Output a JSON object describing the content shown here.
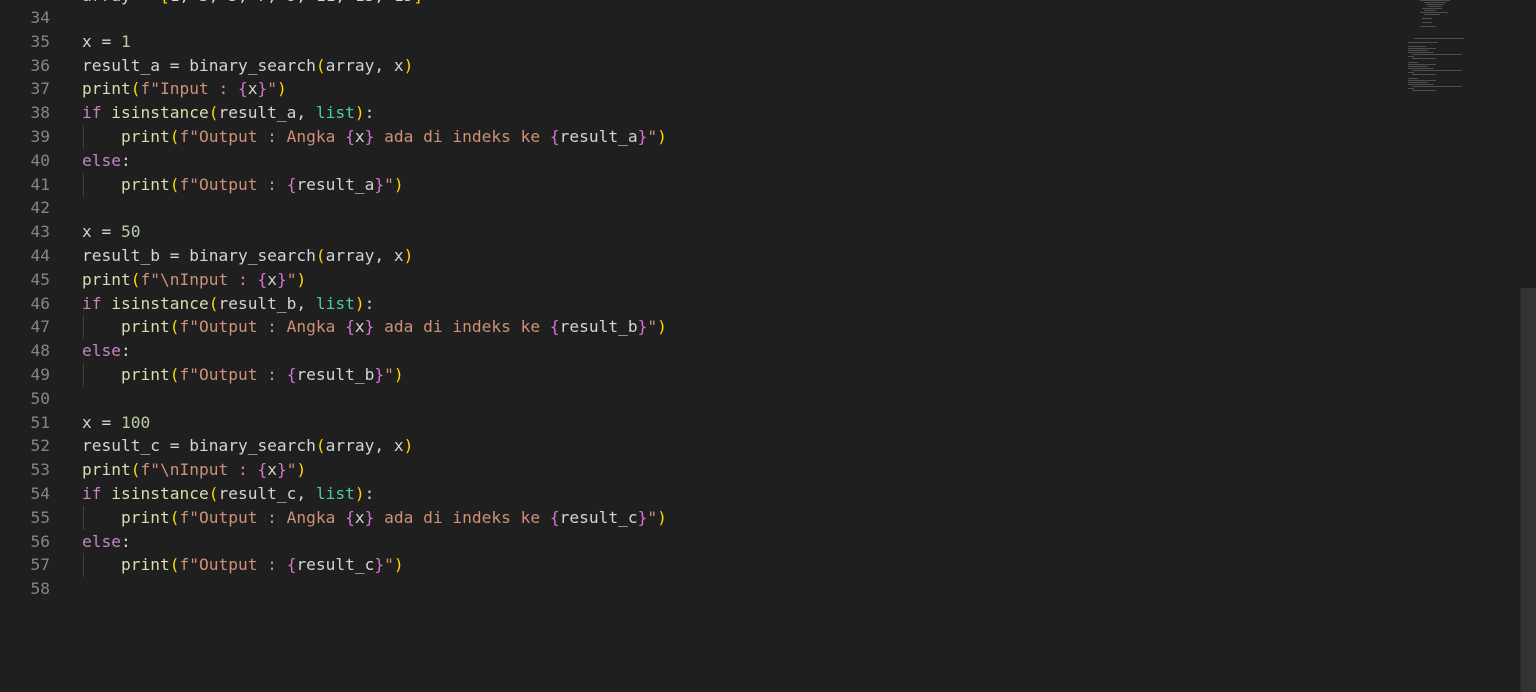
{
  "colors": {
    "background": "#1f1f1f",
    "line_number": "#858585",
    "function": "#dcdcaa",
    "keyword": "#c586c0",
    "variable": "#9cdcfe",
    "class": "#4ec9b0",
    "string": "#ce9178",
    "number": "#b5cea8",
    "bracket_level1": "#ffd700",
    "bracket_level2": "#da70d6"
  },
  "editor": {
    "language": "python",
    "lines": [
      {
        "num": "34",
        "indent": 0,
        "tokens": []
      },
      {
        "num": "35",
        "indent": 0,
        "tokens": [
          [
            "x",
            "pl"
          ],
          [
            " = ",
            "pl"
          ],
          [
            "1",
            "num"
          ]
        ]
      },
      {
        "num": "36",
        "indent": 0,
        "tokens": [
          [
            "result_a",
            "pl"
          ],
          [
            " = ",
            "pl"
          ],
          [
            "binary_search",
            "pl"
          ],
          [
            "(",
            "b1"
          ],
          [
            "array",
            "pl"
          ],
          [
            ", ",
            "pl"
          ],
          [
            "x",
            "pl"
          ],
          [
            ")",
            "b1"
          ]
        ]
      },
      {
        "num": "37",
        "indent": 0,
        "tokens": [
          [
            "print",
            "fn"
          ],
          [
            "(",
            "b1"
          ],
          [
            "f",
            "str"
          ],
          [
            "\"Input : ",
            "str"
          ],
          [
            "{",
            "b2"
          ],
          [
            "x",
            "pl"
          ],
          [
            "}",
            "b2"
          ],
          [
            "\"",
            "str"
          ],
          [
            ")",
            "b1"
          ]
        ]
      },
      {
        "num": "38",
        "indent": 0,
        "tokens": [
          [
            "if",
            "kw"
          ],
          [
            " isinstance",
            "fn"
          ],
          [
            "(",
            "b1"
          ],
          [
            "result_a",
            "pl"
          ],
          [
            ", ",
            "pl"
          ],
          [
            "list",
            "cls"
          ],
          [
            ")",
            "b1"
          ],
          [
            ":",
            "pl"
          ]
        ]
      },
      {
        "num": "39",
        "indent": 1,
        "tokens": [
          [
            "    ",
            "pl"
          ],
          [
            "print",
            "fn"
          ],
          [
            "(",
            "b1"
          ],
          [
            "f",
            "str"
          ],
          [
            "\"Output : Angka ",
            "str"
          ],
          [
            "{",
            "b2"
          ],
          [
            "x",
            "pl"
          ],
          [
            "}",
            "b2"
          ],
          [
            " ada di indeks ke ",
            "str"
          ],
          [
            "{",
            "b2"
          ],
          [
            "result_a",
            "pl"
          ],
          [
            "}",
            "b2"
          ],
          [
            "\"",
            "str"
          ],
          [
            ")",
            "b1"
          ]
        ]
      },
      {
        "num": "40",
        "indent": 0,
        "tokens": [
          [
            "else",
            "kw"
          ],
          [
            ":",
            "pl"
          ]
        ]
      },
      {
        "num": "41",
        "indent": 1,
        "tokens": [
          [
            "    ",
            "pl"
          ],
          [
            "print",
            "fn"
          ],
          [
            "(",
            "b1"
          ],
          [
            "f",
            "str"
          ],
          [
            "\"Output : ",
            "str"
          ],
          [
            "{",
            "b2"
          ],
          [
            "result_a",
            "pl"
          ],
          [
            "}",
            "b2"
          ],
          [
            "\"",
            "str"
          ],
          [
            ")",
            "b1"
          ]
        ]
      },
      {
        "num": "42",
        "indent": 0,
        "tokens": []
      },
      {
        "num": "43",
        "indent": 0,
        "tokens": [
          [
            "x",
            "pl"
          ],
          [
            " = ",
            "pl"
          ],
          [
            "50",
            "num"
          ]
        ]
      },
      {
        "num": "44",
        "indent": 0,
        "tokens": [
          [
            "result_b",
            "pl"
          ],
          [
            " = ",
            "pl"
          ],
          [
            "binary_search",
            "pl"
          ],
          [
            "(",
            "b1"
          ],
          [
            "array",
            "pl"
          ],
          [
            ", ",
            "pl"
          ],
          [
            "x",
            "pl"
          ],
          [
            ")",
            "b1"
          ]
        ]
      },
      {
        "num": "45",
        "indent": 0,
        "tokens": [
          [
            "print",
            "fn"
          ],
          [
            "(",
            "b1"
          ],
          [
            "f",
            "str"
          ],
          [
            "\"\\nInput : ",
            "str"
          ],
          [
            "{",
            "b2"
          ],
          [
            "x",
            "pl"
          ],
          [
            "}",
            "b2"
          ],
          [
            "\"",
            "str"
          ],
          [
            ")",
            "b1"
          ]
        ]
      },
      {
        "num": "46",
        "indent": 0,
        "tokens": [
          [
            "if",
            "kw"
          ],
          [
            " isinstance",
            "fn"
          ],
          [
            "(",
            "b1"
          ],
          [
            "result_b",
            "pl"
          ],
          [
            ", ",
            "pl"
          ],
          [
            "list",
            "cls"
          ],
          [
            ")",
            "b1"
          ],
          [
            ":",
            "pl"
          ]
        ]
      },
      {
        "num": "47",
        "indent": 1,
        "tokens": [
          [
            "    ",
            "pl"
          ],
          [
            "print",
            "fn"
          ],
          [
            "(",
            "b1"
          ],
          [
            "f",
            "str"
          ],
          [
            "\"Output : Angka ",
            "str"
          ],
          [
            "{",
            "b2"
          ],
          [
            "x",
            "pl"
          ],
          [
            "}",
            "b2"
          ],
          [
            " ada di indeks ke ",
            "str"
          ],
          [
            "{",
            "b2"
          ],
          [
            "result_b",
            "pl"
          ],
          [
            "}",
            "b2"
          ],
          [
            "\"",
            "str"
          ],
          [
            ")",
            "b1"
          ]
        ]
      },
      {
        "num": "48",
        "indent": 0,
        "tokens": [
          [
            "else",
            "kw"
          ],
          [
            ":",
            "pl"
          ]
        ]
      },
      {
        "num": "49",
        "indent": 1,
        "tokens": [
          [
            "    ",
            "pl"
          ],
          [
            "print",
            "fn"
          ],
          [
            "(",
            "b1"
          ],
          [
            "f",
            "str"
          ],
          [
            "\"Output : ",
            "str"
          ],
          [
            "{",
            "b2"
          ],
          [
            "result_b",
            "pl"
          ],
          [
            "}",
            "b2"
          ],
          [
            "\"",
            "str"
          ],
          [
            ")",
            "b1"
          ]
        ]
      },
      {
        "num": "50",
        "indent": 0,
        "tokens": []
      },
      {
        "num": "51",
        "indent": 0,
        "tokens": [
          [
            "x",
            "pl"
          ],
          [
            " = ",
            "pl"
          ],
          [
            "100",
            "num"
          ]
        ]
      },
      {
        "num": "52",
        "indent": 0,
        "tokens": [
          [
            "result_c",
            "pl"
          ],
          [
            " = ",
            "pl"
          ],
          [
            "binary_search",
            "pl"
          ],
          [
            "(",
            "b1"
          ],
          [
            "array",
            "pl"
          ],
          [
            ", ",
            "pl"
          ],
          [
            "x",
            "pl"
          ],
          [
            ")",
            "b1"
          ]
        ]
      },
      {
        "num": "53",
        "indent": 0,
        "tokens": [
          [
            "print",
            "fn"
          ],
          [
            "(",
            "b1"
          ],
          [
            "f",
            "str"
          ],
          [
            "\"\\nInput : ",
            "str"
          ],
          [
            "{",
            "b2"
          ],
          [
            "x",
            "pl"
          ],
          [
            "}",
            "b2"
          ],
          [
            "\"",
            "str"
          ],
          [
            ")",
            "b1"
          ]
        ]
      },
      {
        "num": "54",
        "indent": 0,
        "tokens": [
          [
            "if",
            "kw"
          ],
          [
            " isinstance",
            "fn"
          ],
          [
            "(",
            "b1"
          ],
          [
            "result_c",
            "pl"
          ],
          [
            ", ",
            "pl"
          ],
          [
            "list",
            "cls"
          ],
          [
            ")",
            "b1"
          ],
          [
            ":",
            "pl"
          ]
        ]
      },
      {
        "num": "55",
        "indent": 1,
        "tokens": [
          [
            "    ",
            "pl"
          ],
          [
            "print",
            "fn"
          ],
          [
            "(",
            "b1"
          ],
          [
            "f",
            "str"
          ],
          [
            "\"Output : Angka ",
            "str"
          ],
          [
            "{",
            "b2"
          ],
          [
            "x",
            "pl"
          ],
          [
            "}",
            "b2"
          ],
          [
            " ada di indeks ke ",
            "str"
          ],
          [
            "{",
            "b2"
          ],
          [
            "result_c",
            "pl"
          ],
          [
            "}",
            "b2"
          ],
          [
            "\"",
            "str"
          ],
          [
            ")",
            "b1"
          ]
        ]
      },
      {
        "num": "56",
        "indent": 0,
        "tokens": [
          [
            "else",
            "kw"
          ],
          [
            ":",
            "pl"
          ]
        ]
      },
      {
        "num": "57",
        "indent": 1,
        "tokens": [
          [
            "    ",
            "pl"
          ],
          [
            "print",
            "fn"
          ],
          [
            "(",
            "b1"
          ],
          [
            "f",
            "str"
          ],
          [
            "\"Output : ",
            "str"
          ],
          [
            "{",
            "b2"
          ],
          [
            "result_c",
            "pl"
          ],
          [
            "}",
            "b2"
          ],
          [
            "\"",
            "str"
          ],
          [
            ")",
            "b1"
          ]
        ]
      },
      {
        "num": "58",
        "indent": 0,
        "tokens": []
      }
    ]
  }
}
